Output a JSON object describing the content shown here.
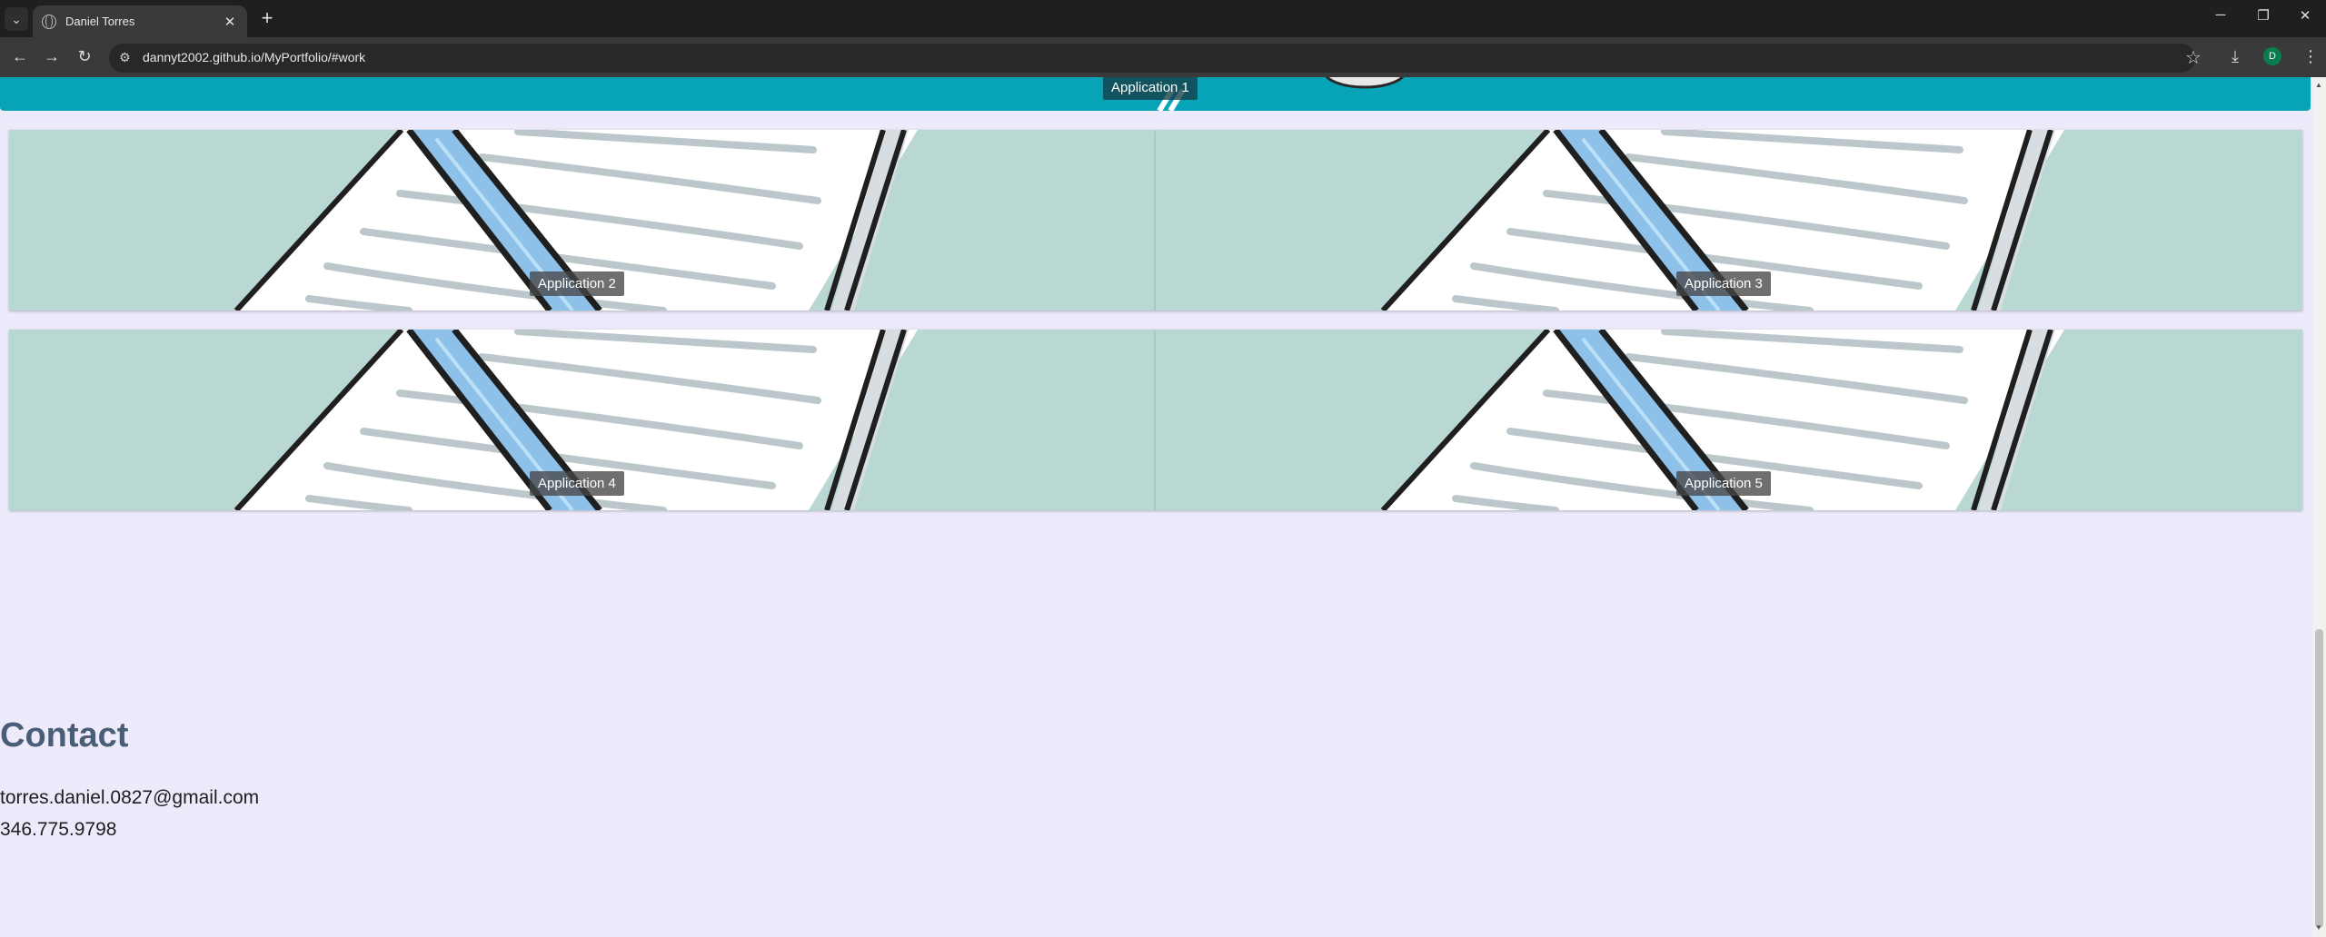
{
  "browser": {
    "tab_title": "Daniel Torres",
    "tab_close": "✕",
    "new_tab": "+",
    "url": "dannyt2002.github.io/MyPortfolio/#work",
    "profile_initial": "D",
    "window_controls": {
      "minimize": "─",
      "restore": "❐",
      "close": "✕"
    }
  },
  "work": {
    "applications": [
      {
        "label": "Application 1"
      },
      {
        "label": "Application 2"
      },
      {
        "label": "Application 3"
      },
      {
        "label": "Application 4"
      },
      {
        "label": "Application 5"
      }
    ],
    "card_image_icon": "pencil-writing-on-paper-icon"
  },
  "contact": {
    "title": "Contact",
    "email": "torres.daniel.0827@gmail.com",
    "phone": "346.775.9798"
  },
  "colors": {
    "page_bg": "#edebfb",
    "card_bg": "#b9d8d3",
    "accent_strip": "#07a3b6",
    "contact_title": "#4a5d77"
  }
}
